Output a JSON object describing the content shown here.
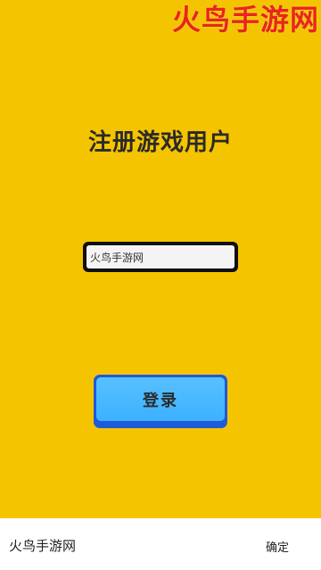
{
  "watermark": "火鸟手游网",
  "title": "注册游戏用户",
  "username_input": {
    "value": "火鸟手游网",
    "placeholder": ""
  },
  "login_button": {
    "label": "登录"
  },
  "bottom_bar": {
    "label": "火鸟手游网",
    "confirm_label": "确定"
  },
  "colors": {
    "background": "#f5c400",
    "watermark": "#e8261a",
    "button_face": "#3db1ff",
    "button_border": "#1f5ad8"
  }
}
